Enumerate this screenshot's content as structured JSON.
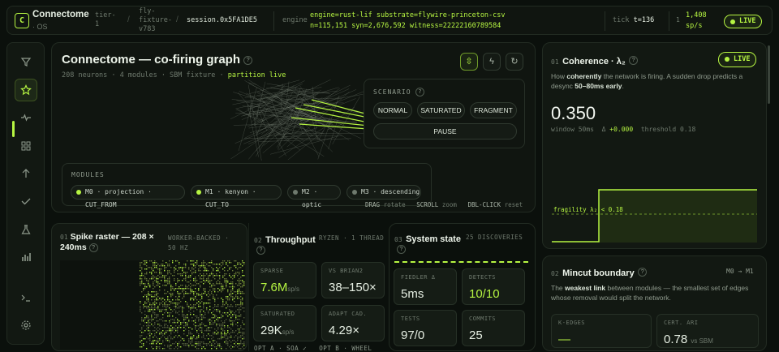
{
  "topbar": {
    "logo_letter": "C",
    "app_title": "Connectome",
    "app_sub": "· OS",
    "crumb_tier": "tier-1",
    "crumb_fixture": "fly-fixture-v783",
    "crumb_session": "session.0x5FA1DE5",
    "engine_label": "engine",
    "engine_text": "engine=rust-lif substrate=flywire-princeton-csv n=115,151 syn=2,676,592 witness=22222160789584",
    "tick_label": "tick",
    "tick_value": "t=136",
    "rate_prefix": "1",
    "rate": "1,408 sp/s",
    "live": "LIVE"
  },
  "sidebar": {
    "icons": [
      "filter-icon",
      "star-icon",
      "pulse-icon",
      "grid-icon",
      "arrow-up-icon",
      "check-icon",
      "flask-icon",
      "bar-chart-icon",
      "terminal-icon",
      "gear-icon"
    ]
  },
  "graph": {
    "title": "Connectome — co-firing graph",
    "meta_plain": "208 neurons · 4 modules · SBM fixture · ",
    "meta_accent": "partition live",
    "scenario_label": "SCENARIO",
    "scenario_options": [
      "NORMAL",
      "SATURATED",
      "FRAGMENT"
    ],
    "pause": "PAUSE",
    "modules_label": "MODULES",
    "modules": [
      {
        "label": "M0 · projection · CUT_FROM",
        "color": "#b6f542"
      },
      {
        "label": "M1 · kenyon · CUT_TO",
        "color": "#b6f542"
      },
      {
        "label": "M2 · optic",
        "color": "#6f7a6e"
      },
      {
        "label": "M3 · descending",
        "color": "#6f7a6e"
      }
    ],
    "hint_drag": "DRAG",
    "hint_drag_action": "rotate",
    "hint_scroll": "SCROLL",
    "hint_scroll_action": "zoom",
    "hint_dbl": "DBL-CLICK",
    "hint_dbl_action": "reset"
  },
  "coherence": {
    "num": "01",
    "title": "Coherence · λ₂",
    "live": "LIVE",
    "desc_1": "How ",
    "desc_bold": "coherently",
    "desc_2": " the network is firing. A sudden drop predicts a desync ",
    "desc_bold2": "50–80ms early",
    "desc_3": ".",
    "value": "0.350",
    "window": "window 50ms",
    "delta_label": "Δ",
    "delta": "+0.000",
    "threshold": "threshold 0.18",
    "fragility_label": "fragility λ₂ < 0.18"
  },
  "raster": {
    "num": "01",
    "title": "Spike raster — 208 × 240ms",
    "badge": "WORKER-BACKED · 50 HZ"
  },
  "throughput": {
    "num": "02",
    "title": "Throughput",
    "badge": "RYZEN · 1 THREAD",
    "stats": [
      {
        "label": "SPARSE",
        "value": "7.6M",
        "unit": "sp/s",
        "accent": true
      },
      {
        "label": "VS BRIAN2",
        "value": "38–150×",
        "unit": "",
        "accent": false
      },
      {
        "label": "SATURATED",
        "value": "29K",
        "unit": "sp/s",
        "accent": false
      },
      {
        "label": "ADAPT CAD.",
        "value": "4.29×",
        "unit": "",
        "accent": false
      }
    ],
    "footer_a": "OPT A · SOA ✓",
    "footer_b": "OPT B · WHEEL"
  },
  "system": {
    "num": "03",
    "title": "System state",
    "badge": "25 DISCOVERIES",
    "stats": [
      {
        "label": "FIEDLER Δ",
        "value": "5ms",
        "accent": false
      },
      {
        "label": "DETECTS",
        "value": "10/10",
        "accent": true
      },
      {
        "label": "TESTS",
        "value": "97/0",
        "accent": false
      },
      {
        "label": "COMMITS",
        "value": "25",
        "accent": false
      }
    ]
  },
  "mincut": {
    "num": "02",
    "title": "Mincut boundary",
    "pair": "M0 → M1",
    "desc_1": "The ",
    "desc_bold": "weakest link",
    "desc_2": " between modules — the smallest set of edges whose removal would split the network.",
    "stats": [
      {
        "label": "K-EDGES",
        "value": "—",
        "unit": "",
        "accent": true
      },
      {
        "label": "CERT. ARI",
        "value": "0.78",
        "unit": "vs SBM",
        "accent": false
      }
    ]
  },
  "colors": {
    "accent": "#b6f542",
    "background": "#0b100c",
    "panel": "#121812"
  }
}
